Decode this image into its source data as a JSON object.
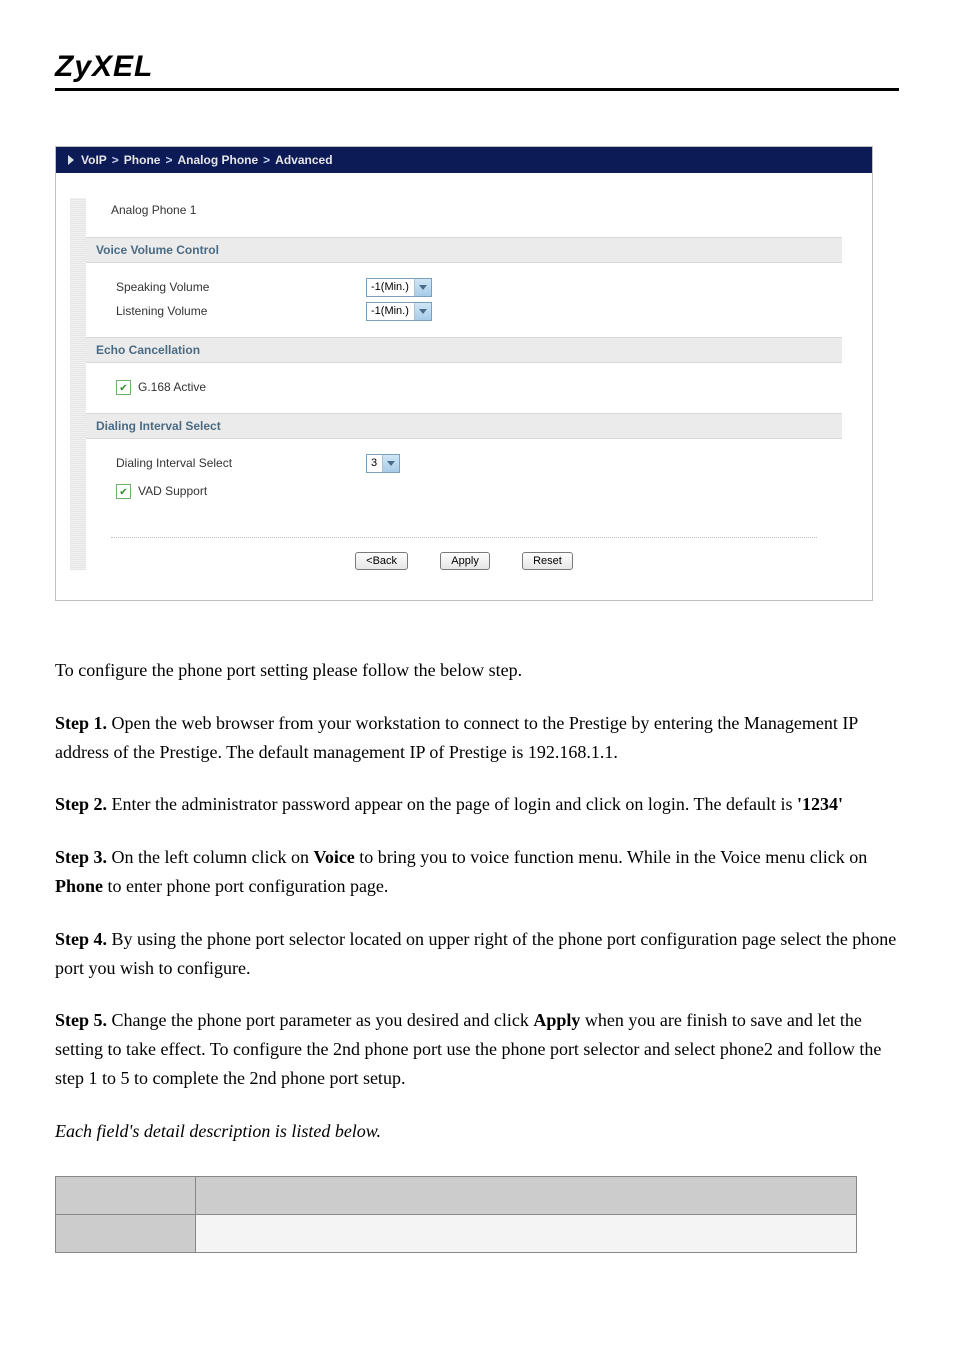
{
  "brand": "ZyXEL",
  "breadcrumb": {
    "items": [
      "VoIP",
      "Phone",
      "Analog Phone",
      "Advanced"
    ]
  },
  "panel": {
    "title": "Analog Phone 1",
    "sections": {
      "voice": {
        "header": "Voice Volume Control",
        "speaking_label": "Speaking Volume",
        "speaking_value": "-1(Min.)",
        "listening_label": "Listening Volume",
        "listening_value": "-1(Min.)"
      },
      "echo": {
        "header": "Echo Cancellation",
        "g168_label": "G.168 Active",
        "g168_checked": true
      },
      "dialing": {
        "header": "Dialing Interval Select",
        "interval_label": "Dialing Interval Select",
        "interval_value": "3",
        "vad_label": "VAD Support",
        "vad_checked": true
      }
    },
    "buttons": {
      "back": "<Back",
      "apply": "Apply",
      "reset": "Reset"
    }
  },
  "doc": {
    "intro": "To configure the phone port setting please follow the below step.",
    "step1_label": "Step 1.",
    "step1_text": " Open the web browser from your workstation to connect to the Prestige by entering the Management IP address of the Prestige.  The default management IP of Prestige is 192.168.1.1.",
    "step2_label": "Step 2.",
    "step2_text_a": " Enter the administrator password appear on the page of login and click on login. The default is ",
    "step2_bold": "'1234'",
    "step3_label": "Step 3.",
    "step3_text_a": " On the left column click on ",
    "step3_bold_a": "Voice",
    "step3_text_b": " to bring you to voice function menu.  While in the Voice menu click on ",
    "step3_bold_b": "Phone",
    "step3_text_c": " to enter phone port configuration page.",
    "step4_label": "Step 4.",
    "step4_text": " By using the phone port selector located on upper right of the phone port configuration page select the phone port you wish to configure.",
    "step5_label": "Step 5.",
    "step5_text_a": " Change the phone port parameter as you desired and click ",
    "step5_bold": "Apply",
    "step5_text_b": " when you are finish to save and let the setting to take effect.  To configure the 2nd phone port use the phone port selector and select phone2 and follow the step 1 to 5 to complete the 2nd phone port setup.",
    "footnote": "Each field's detail description is listed below."
  }
}
